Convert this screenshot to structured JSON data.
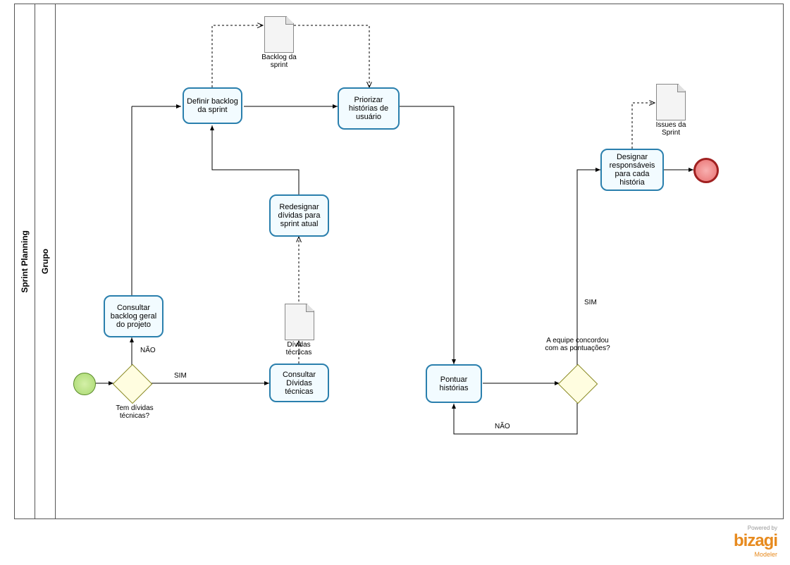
{
  "pool": {
    "title": "Sprint Planning"
  },
  "lane": {
    "title": "Grupo"
  },
  "tasks": {
    "consultar_backlog": "Consultar backlog geral do projeto",
    "definir_backlog": "Definir backlog da sprint",
    "consultar_dividas": "Consultar Dívidas técnicas",
    "redesignar": "Redesignar dívidas para sprint atual",
    "priorizar": "Priorizar histórias de usuário",
    "pontuar": "Pontuar histórias",
    "designar": "Designar responsáveis para cada história"
  },
  "documents": {
    "backlog_sprint": "Backlog da sprint",
    "dividas_tecnicas": "Dívidas técnicas",
    "issues_sprint": "Issues da Sprint"
  },
  "gateways": {
    "tem_dividas": "Tem dívidas técnicas?",
    "equipe_concordou": "A equipe concordou com as pontuações?"
  },
  "labels": {
    "sim": "SIM",
    "nao": "NÃO"
  },
  "logo": {
    "powered": "Powered by",
    "brand": "bizagi",
    "modeler": "Modeler"
  }
}
